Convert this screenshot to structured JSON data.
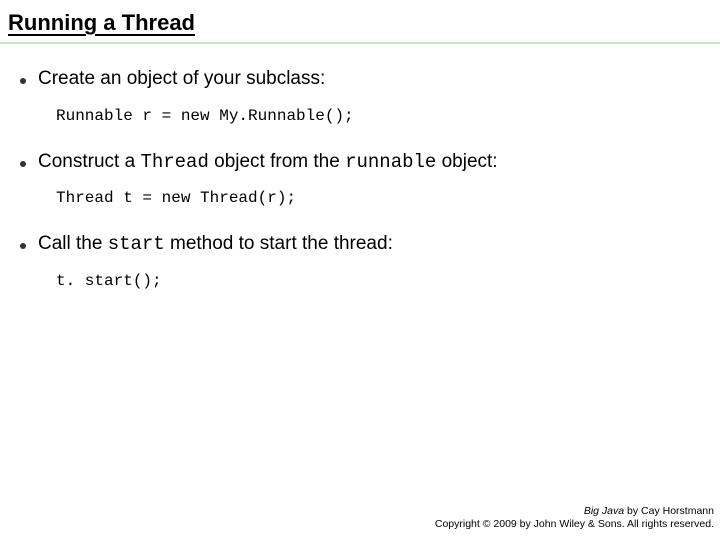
{
  "title": "Running a Thread",
  "bullets": [
    {
      "pre": "Create an object of your subclass:",
      "code_inline1": "",
      "mid": "",
      "code_inline2": "",
      "post": "",
      "code_block": "Runnable r = new My.Runnable();"
    },
    {
      "pre": "Construct a ",
      "code_inline1": "Thread",
      "mid": " object from the ",
      "code_inline2": "runnable",
      "post": " object:",
      "code_block": "Thread t = new Thread(r);"
    },
    {
      "pre": "Call the ",
      "code_inline1": "start",
      "mid": " method to start the thread:",
      "code_inline2": "",
      "post": "",
      "code_block": "t. start();"
    }
  ],
  "footer": {
    "book": "Big Java",
    "author": " by Cay Horstmann",
    "copyright": "Copyright © 2009 by John Wiley & Sons. All rights reserved."
  }
}
